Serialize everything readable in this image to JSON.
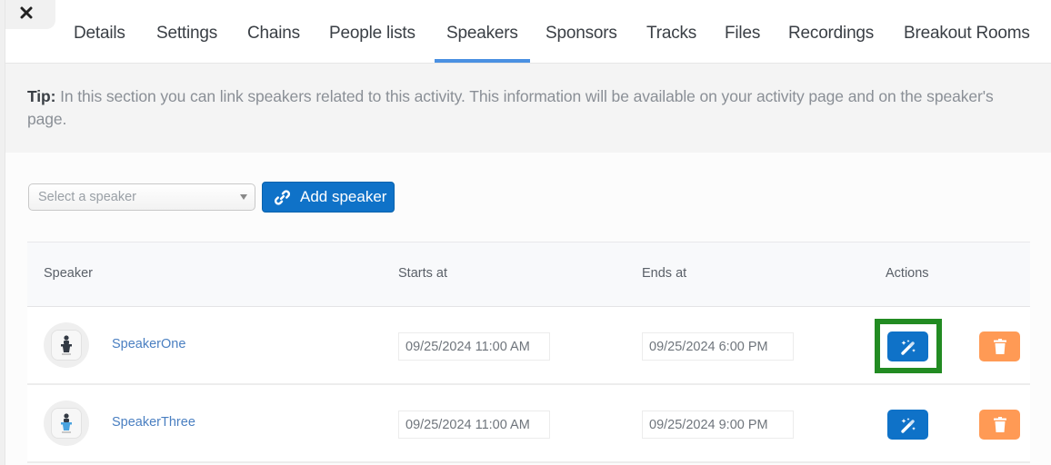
{
  "tabs": [
    {
      "label": "Details",
      "active": false
    },
    {
      "label": "Settings",
      "active": false
    },
    {
      "label": "Chains",
      "active": false
    },
    {
      "label": "People lists",
      "active": false
    },
    {
      "label": "Speakers",
      "active": true
    },
    {
      "label": "Sponsors",
      "active": false
    },
    {
      "label": "Tracks",
      "active": false
    },
    {
      "label": "Files",
      "active": false
    },
    {
      "label": "Recordings",
      "active": false
    },
    {
      "label": "Breakout Rooms",
      "active": false
    }
  ],
  "close_icon": "close-icon",
  "tip": {
    "label": "Tip:",
    "text": " In this section you can link speakers related to this activity. This information will be available on your activity page and on the speaker's page."
  },
  "speaker_select": {
    "placeholder": "Select a speaker"
  },
  "add_speaker_button": {
    "label": "Add speaker",
    "icon": "link-icon"
  },
  "table": {
    "headers": {
      "speaker": "Speaker",
      "starts_at": "Starts at",
      "ends_at": "Ends at",
      "actions": "Actions"
    },
    "rows": [
      {
        "name": "SpeakerOne",
        "avatar": "podium-speaker-icon",
        "starts_at": "09/25/2024 11:00 AM",
        "ends_at": "09/25/2024 6:00 PM",
        "edit_icon": "magic-wand-icon",
        "delete_icon": "trash-icon",
        "highlighted": true
      },
      {
        "name": "SpeakerThree",
        "avatar": "podium-speaker-icon",
        "starts_at": "09/25/2024 11:00 AM",
        "ends_at": "09/25/2024 9:00 PM",
        "edit_icon": "magic-wand-icon",
        "delete_icon": "trash-icon",
        "highlighted": false
      }
    ]
  },
  "colors": {
    "accent_blue": "#0f72c8",
    "tab_underline": "#4a90e2",
    "delete_orange": "#ff9a55",
    "link_text": "#4a7fc1",
    "highlight_green": "#228b22"
  }
}
